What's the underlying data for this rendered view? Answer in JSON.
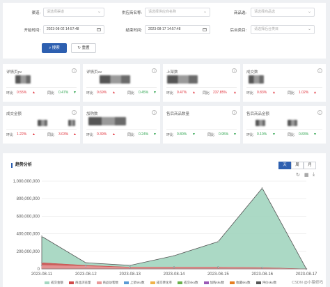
{
  "filters": {
    "store_label": "渠道:",
    "store_placeholder": "请选择渠道",
    "supplier_label": "供应商名称:",
    "supplier_placeholder": "请选择供应商名称",
    "category_label": "商品选:",
    "category_placeholder": "请选择商品选",
    "start_label": "开始时间:",
    "start_value": "2023-08-02 14:57:48",
    "end_label": "结束时间:",
    "end_value": "2023-08-17 14:57:48",
    "backend_label": "后台类目:",
    "backend_placeholder": "请选择后台类目",
    "search_label": "搜索",
    "reset_label": "重置"
  },
  "cards": [
    {
      "title": "详情页pv",
      "cmp1": "环比",
      "v1": "0.55%",
      "d1": "up",
      "cmp2": "同比",
      "v2": "0.47%",
      "d2": "down"
    },
    {
      "title": "详情页uv",
      "cmp1": "环比",
      "v1": "0.69%",
      "d1": "up",
      "cmp2": "同比",
      "v2": "0.45%",
      "d2": "down"
    },
    {
      "title": "上架数",
      "cmp1": "环比",
      "v1": "0.47%",
      "d1": "up",
      "cmp2": "同比",
      "v2": "237.85%",
      "d2": "up"
    },
    {
      "title": "成交数",
      "cmp1": "环比",
      "v1": "0.83%",
      "d1": "up",
      "cmp2": "同比",
      "v2": "1.02%",
      "d2": "up"
    },
    {
      "title": "成交金额",
      "cmp1": "环比",
      "v1": "1.22%",
      "d1": "up",
      "cmp2": "同比",
      "v2": "3.03%",
      "d2": "up"
    },
    {
      "title": "加购数",
      "cmp1": "环比",
      "v1": "0.39%",
      "d1": "up",
      "cmp2": "同比",
      "v2": "0.24%",
      "d2": "down"
    },
    {
      "title": "售后商品数量",
      "cmp1": "环比",
      "v1": "0.80%",
      "d1": "down",
      "cmp2": "同比",
      "v2": "0.95%",
      "d2": "down"
    },
    {
      "title": "售后商品金额",
      "cmp1": "环比",
      "v1": "0.10%",
      "d1": "down",
      "cmp2": "同比",
      "v2": "0.83%",
      "d2": "down"
    }
  ],
  "trend": {
    "title": "趋势分析",
    "tabs": [
      "天",
      "周",
      "月"
    ],
    "active_tab": "天",
    "watermark": "CSDN @小猿修吗"
  },
  "chart_data": {
    "type": "area",
    "title": "",
    "x": [
      "2023-08-11",
      "2023-08-12",
      "2023-08-13",
      "2023-08-14",
      "2023-08-15",
      "2023-08-16",
      "2023-08-17"
    ],
    "ylim": [
      0,
      1000000000
    ],
    "yticks": [
      "1,000,000,000",
      "800,000,000",
      "600,000,000",
      "400,000,000",
      "200,000,000",
      "0"
    ],
    "grid": true,
    "legend_position": "bottom",
    "series": [
      {
        "name": "成交金额",
        "color": "#a6d7c2",
        "values": [
          370000000,
          70000000,
          40000000,
          150000000,
          310000000,
          920000000,
          0
        ]
      },
      {
        "name": "商品浏览量",
        "color": "#d04a4a",
        "values": [
          70000000,
          40000000,
          20000000,
          20000000,
          20000000,
          15000000,
          0
        ]
      },
      {
        "name": "商品访客数",
        "color": "#e89a9a",
        "values": [
          40000000,
          30000000,
          15000000,
          15000000,
          15000000,
          10000000,
          0
        ]
      },
      {
        "name": "上架sku数",
        "color": "#5b9bd5",
        "values": [
          0,
          0,
          0,
          0,
          0,
          0,
          0
        ]
      },
      {
        "name": "成交转化率",
        "color": "#f0b24a",
        "values": [
          0,
          0,
          0,
          0,
          0,
          0,
          0
        ]
      },
      {
        "name": "成交sku数",
        "color": "#6ab04c",
        "values": [
          0,
          0,
          0,
          0,
          0,
          0,
          0
        ]
      },
      {
        "name": "加购sku数",
        "color": "#9b59b6",
        "values": [
          0,
          0,
          0,
          0,
          0,
          0,
          0
        ]
      },
      {
        "name": "收藏sku数",
        "color": "#e67e22",
        "values": [
          0,
          0,
          0,
          0,
          0,
          0,
          0
        ]
      },
      {
        "name": "评价sku数",
        "color": "#555555",
        "values": [
          0,
          0,
          0,
          0,
          0,
          0,
          0
        ]
      }
    ]
  }
}
